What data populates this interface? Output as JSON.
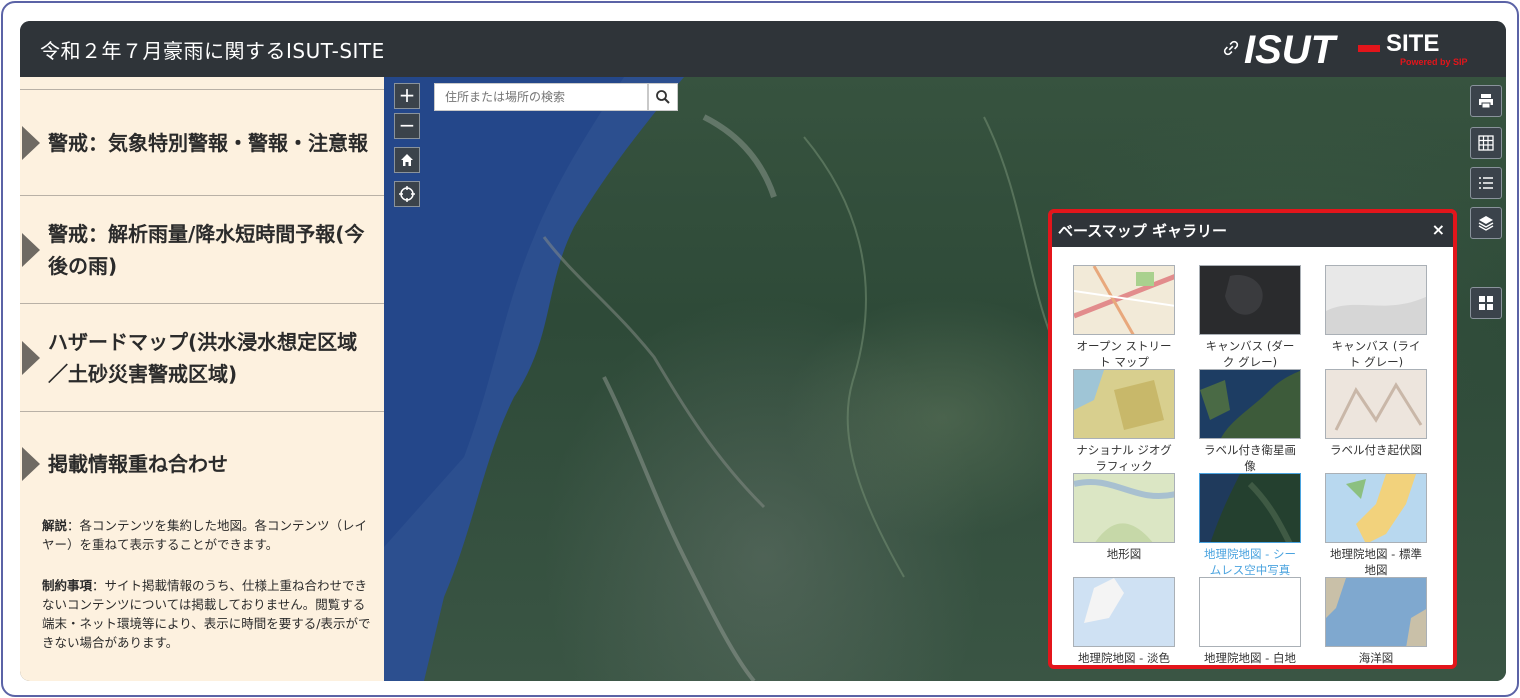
{
  "header": {
    "title": "令和２年７月豪雨に関するISUT-SITE",
    "logo_text": "ISUT-SITE",
    "logo_sub": "Powered by SIP"
  },
  "sidebar": {
    "items": [
      {
        "label": "警戒：気象特別警報・警報・注意報"
      },
      {
        "label": "警戒：解析雨量/降水短時間予報(今後の雨)"
      },
      {
        "label": "ハザードマップ(洪水浸水想定区域／土砂災害警戒区域)"
      },
      {
        "label": "掲載情報重ね合わせ"
      }
    ],
    "note1_title": "解説",
    "note1_body": "：各コンテンツを集約した地図。各コンテンツ（レイヤー）を重ねて表示することができます。",
    "note2_title": "制約事項",
    "note2_body": "：サイト掲載情報のうち、仕様上重ね合わせできないコンテンツについては掲載しておりません。閲覧する端末・ネット環境等により、表示に時間を要する/表示ができない場合があります。"
  },
  "map": {
    "zoom_in": "+",
    "zoom_out": "−",
    "search_placeholder": "住所または場所の検索"
  },
  "gallery": {
    "title": "ベースマップ ギャラリー",
    "close": "×",
    "tiles": [
      {
        "label": "オープン ストリート マップ",
        "thumb": "osm"
      },
      {
        "label": "キャンバス (ダーク グレー)",
        "thumb": "dark"
      },
      {
        "label": "キャンバス (ライト グレー)",
        "thumb": "light"
      },
      {
        "label": "ナショナル ジオグラフィック",
        "thumb": "natgeo"
      },
      {
        "label": "ラベル付き衛星画像",
        "thumb": "sat"
      },
      {
        "label": "ラベル付き起伏図",
        "thumb": "relief"
      },
      {
        "label": "地形図",
        "thumb": "topo"
      },
      {
        "label": "地理院地図 - シームレス空中写真",
        "thumb": "photo",
        "selected": true
      },
      {
        "label": "地理院地図 - 標準地図",
        "thumb": "std"
      },
      {
        "label": "地理院地図 - 淡色",
        "thumb": "pale"
      },
      {
        "label": "地理院地図 - 白地",
        "thumb": "blank"
      },
      {
        "label": "海洋図",
        "thumb": "ocean"
      }
    ]
  },
  "colors": {
    "header_bg": "#2f3439",
    "sidebar_bg": "#fdf1df",
    "highlight_border": "#e3151b",
    "selected_label": "#4aa3df"
  }
}
